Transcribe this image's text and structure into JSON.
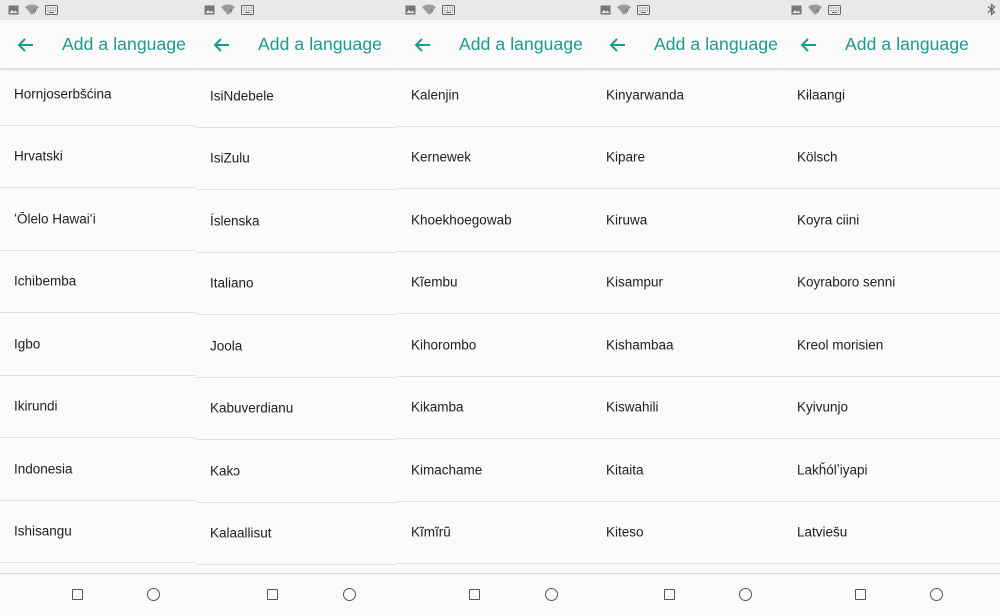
{
  "colors": {
    "accent": "#1c9a8c",
    "text": "#212121",
    "background": "#fafafa"
  },
  "icons": {
    "back": "arrow-left-icon",
    "recents": "square-icon",
    "home": "circle-icon"
  },
  "panels": [
    {
      "title": "Add a language",
      "items": [
        "Hornjoserbšćina",
        "Hrvatski",
        "ʻŌlelo Hawaiʻi",
        "Ichibemba",
        "Igbo",
        "Ikirundi",
        "Indonesia",
        "Ishisangu"
      ]
    },
    {
      "title": "Add a language",
      "items": [
        "IsiNdebele",
        "IsiZulu",
        "Íslenska",
        "Italiano",
        "Joola",
        "Kabuverdianu",
        "Kakɔ",
        "Kalaallisut"
      ]
    },
    {
      "title": "Add a language",
      "items": [
        "Kalenjin",
        "Kernewek",
        "Khoekhoegowab",
        "Kĩembu",
        "Kihorombo",
        "Kikamba",
        "Kimachame",
        "Kĩmĩrũ"
      ]
    },
    {
      "title": "Add a language",
      "items": [
        "Kinyarwanda",
        "Kipare",
        "Kiruwa",
        "Kisampur",
        "Kishambaa",
        "Kiswahili",
        "Kitaita",
        "Kiteso"
      ]
    },
    {
      "title": "Add a language",
      "items": [
        "Kɨlaangi",
        "Kölsch",
        "Koyra ciini",
        "Koyraboro senni",
        "Kreol morisien",
        "Kyivunjo",
        "Lakȟólʼiyapi",
        "Latviešu"
      ]
    }
  ]
}
